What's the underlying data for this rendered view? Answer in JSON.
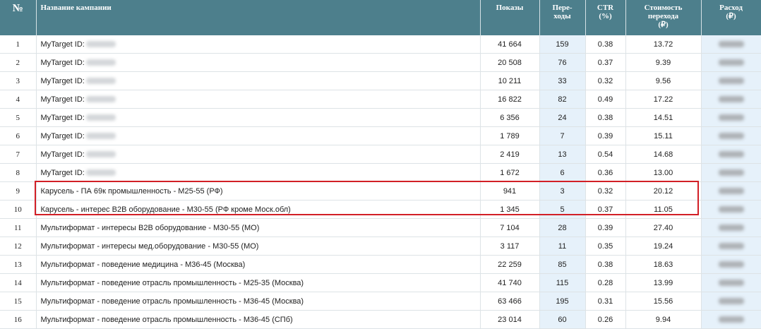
{
  "table": {
    "headers": {
      "num": "№",
      "name": "Название кампании",
      "impressions": "Показы",
      "clicks": "Пере-\nходы",
      "ctr": "CTR\n(%)",
      "cpc": "Стоимость\nперехода\n(₽)",
      "spend": "Расход\n(₽)"
    },
    "rows": [
      {
        "num": "1",
        "name": "MyTarget ID:",
        "impressions": "41 664",
        "clicks": "159",
        "ctr": "0.38",
        "cpc": "13.72"
      },
      {
        "num": "2",
        "name": "MyTarget ID:",
        "impressions": "20 508",
        "clicks": "76",
        "ctr": "0.37",
        "cpc": "9.39"
      },
      {
        "num": "3",
        "name": "MyTarget ID:",
        "impressions": "10 211",
        "clicks": "33",
        "ctr": "0.32",
        "cpc": "9.56"
      },
      {
        "num": "4",
        "name": "MyTarget ID:",
        "impressions": "16 822",
        "clicks": "82",
        "ctr": "0.49",
        "cpc": "17.22"
      },
      {
        "num": "5",
        "name": "MyTarget ID:",
        "impressions": "6 356",
        "clicks": "24",
        "ctr": "0.38",
        "cpc": "14.51"
      },
      {
        "num": "6",
        "name": "MyTarget ID:",
        "impressions": "1 789",
        "clicks": "7",
        "ctr": "0.39",
        "cpc": "15.11"
      },
      {
        "num": "7",
        "name": "MyTarget ID:",
        "impressions": "2 419",
        "clicks": "13",
        "ctr": "0.54",
        "cpc": "14.68"
      },
      {
        "num": "8",
        "name": "MyTarget ID:",
        "impressions": "1 672",
        "clicks": "6",
        "ctr": "0.36",
        "cpc": "13.00"
      },
      {
        "num": "9",
        "name": "Карусель - ПА 69к промышленность - М25-55 (РФ)",
        "impressions": "941",
        "clicks": "3",
        "ctr": "0.32",
        "cpc": "20.12"
      },
      {
        "num": "10",
        "name": "Карусель - интерес B2B оборудование - М30-55 (РФ кроме Моск.обл)",
        "impressions": "1 345",
        "clicks": "5",
        "ctr": "0.37",
        "cpc": "11.05"
      },
      {
        "num": "11",
        "name": "Мультиформат - интересы B2B оборудование - М30-55 (МО)",
        "impressions": "7 104",
        "clicks": "28",
        "ctr": "0.39",
        "cpc": "27.40"
      },
      {
        "num": "12",
        "name": "Мультиформат - интересы мед.оборудование - М30-55 (МО)",
        "impressions": "3 117",
        "clicks": "11",
        "ctr": "0.35",
        "cpc": "19.24"
      },
      {
        "num": "13",
        "name": "Мультиформат - поведение медицина - М36-45 (Москва)",
        "impressions": "22 259",
        "clicks": "85",
        "ctr": "0.38",
        "cpc": "18.63"
      },
      {
        "num": "14",
        "name": "Мультиформат - поведение отрасль промышленность - М25-35 (Москва)",
        "impressions": "41 740",
        "clicks": "115",
        "ctr": "0.28",
        "cpc": "13.99"
      },
      {
        "num": "15",
        "name": "Мультиформат - поведение отрасль промышленность - М36-45 (Москва)",
        "impressions": "63 466",
        "clicks": "195",
        "ctr": "0.31",
        "cpc": "15.56"
      },
      {
        "num": "16",
        "name": "Мультиформат - поведение отрасль промышленность - М36-45 (СПб)",
        "impressions": "23 014",
        "clicks": "60",
        "ctr": "0.26",
        "cpc": "9.94"
      }
    ]
  },
  "colors": {
    "header_bg": "#4d7f8c",
    "highlight_border": "#d21f26",
    "column_tint": "#e6f1fa"
  }
}
